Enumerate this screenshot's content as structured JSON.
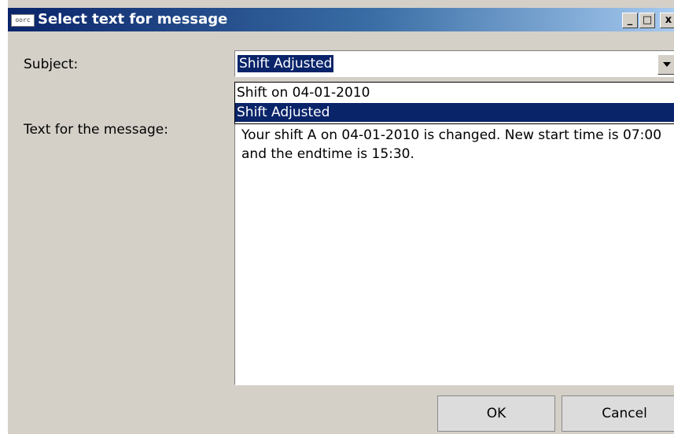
{
  "window": {
    "title": "Select text for message",
    "app_icon_text": "oorc",
    "icon": "app-icon",
    "controls": {
      "minimize": "_",
      "maximize": "□",
      "close": "x"
    }
  },
  "form": {
    "subject_label": "Subject:",
    "message_label": "Text for the message:"
  },
  "subject_combo": {
    "value": "Shift Adjusted",
    "arrow_icon": "triangle-down-icon",
    "options": [
      {
        "label": "Shift on 04-01-2010",
        "selected": false
      },
      {
        "label": "Shift Adjusted",
        "selected": true
      }
    ]
  },
  "message": {
    "text": "Your shift A on 04-01-2010 is changed. New start time is 07:00 and the endtime is 15:30."
  },
  "buttons": {
    "ok": "OK",
    "cancel": "Cancel"
  },
  "colors": {
    "titlebar_start": "#0a246a",
    "titlebar_end": "#a6caf0",
    "selection": "#0a246a",
    "dialog_bg": "#d4d0c8"
  }
}
